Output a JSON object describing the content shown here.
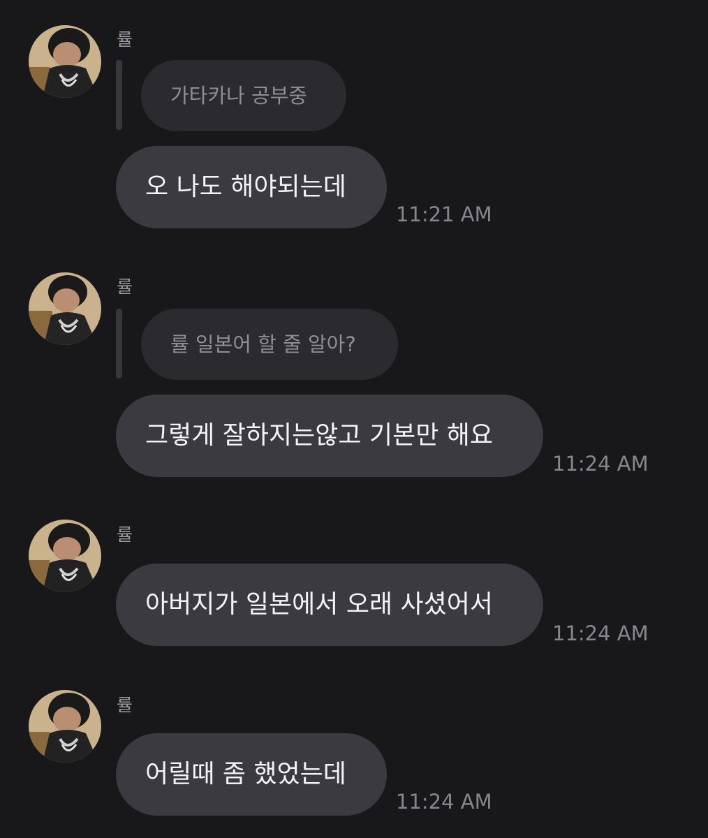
{
  "messages": [
    {
      "sender": "률",
      "reply_quote": "가타카나 공부중",
      "text": "오 나도 해야되는데",
      "time": "11:21 AM"
    },
    {
      "sender": "률",
      "reply_quote": "률 일본어 할 줄 알아?",
      "text": "그렇게 잘하지는않고 기본만 해요",
      "time": "11:24 AM"
    },
    {
      "sender": "률",
      "text": "아버지가 일본에서 오래 사셨어서",
      "time": "11:24 AM"
    },
    {
      "sender": "률",
      "text": "어릴때 좀 했었는데",
      "time": "11:24 AM"
    }
  ],
  "colors": {
    "background": "#18181b",
    "bubble": "#3a3a40",
    "reply_bubble": "#2a2a2f",
    "timestamp": "#86868d"
  },
  "icons": {
    "avatar": "profile-photo-avatar"
  }
}
